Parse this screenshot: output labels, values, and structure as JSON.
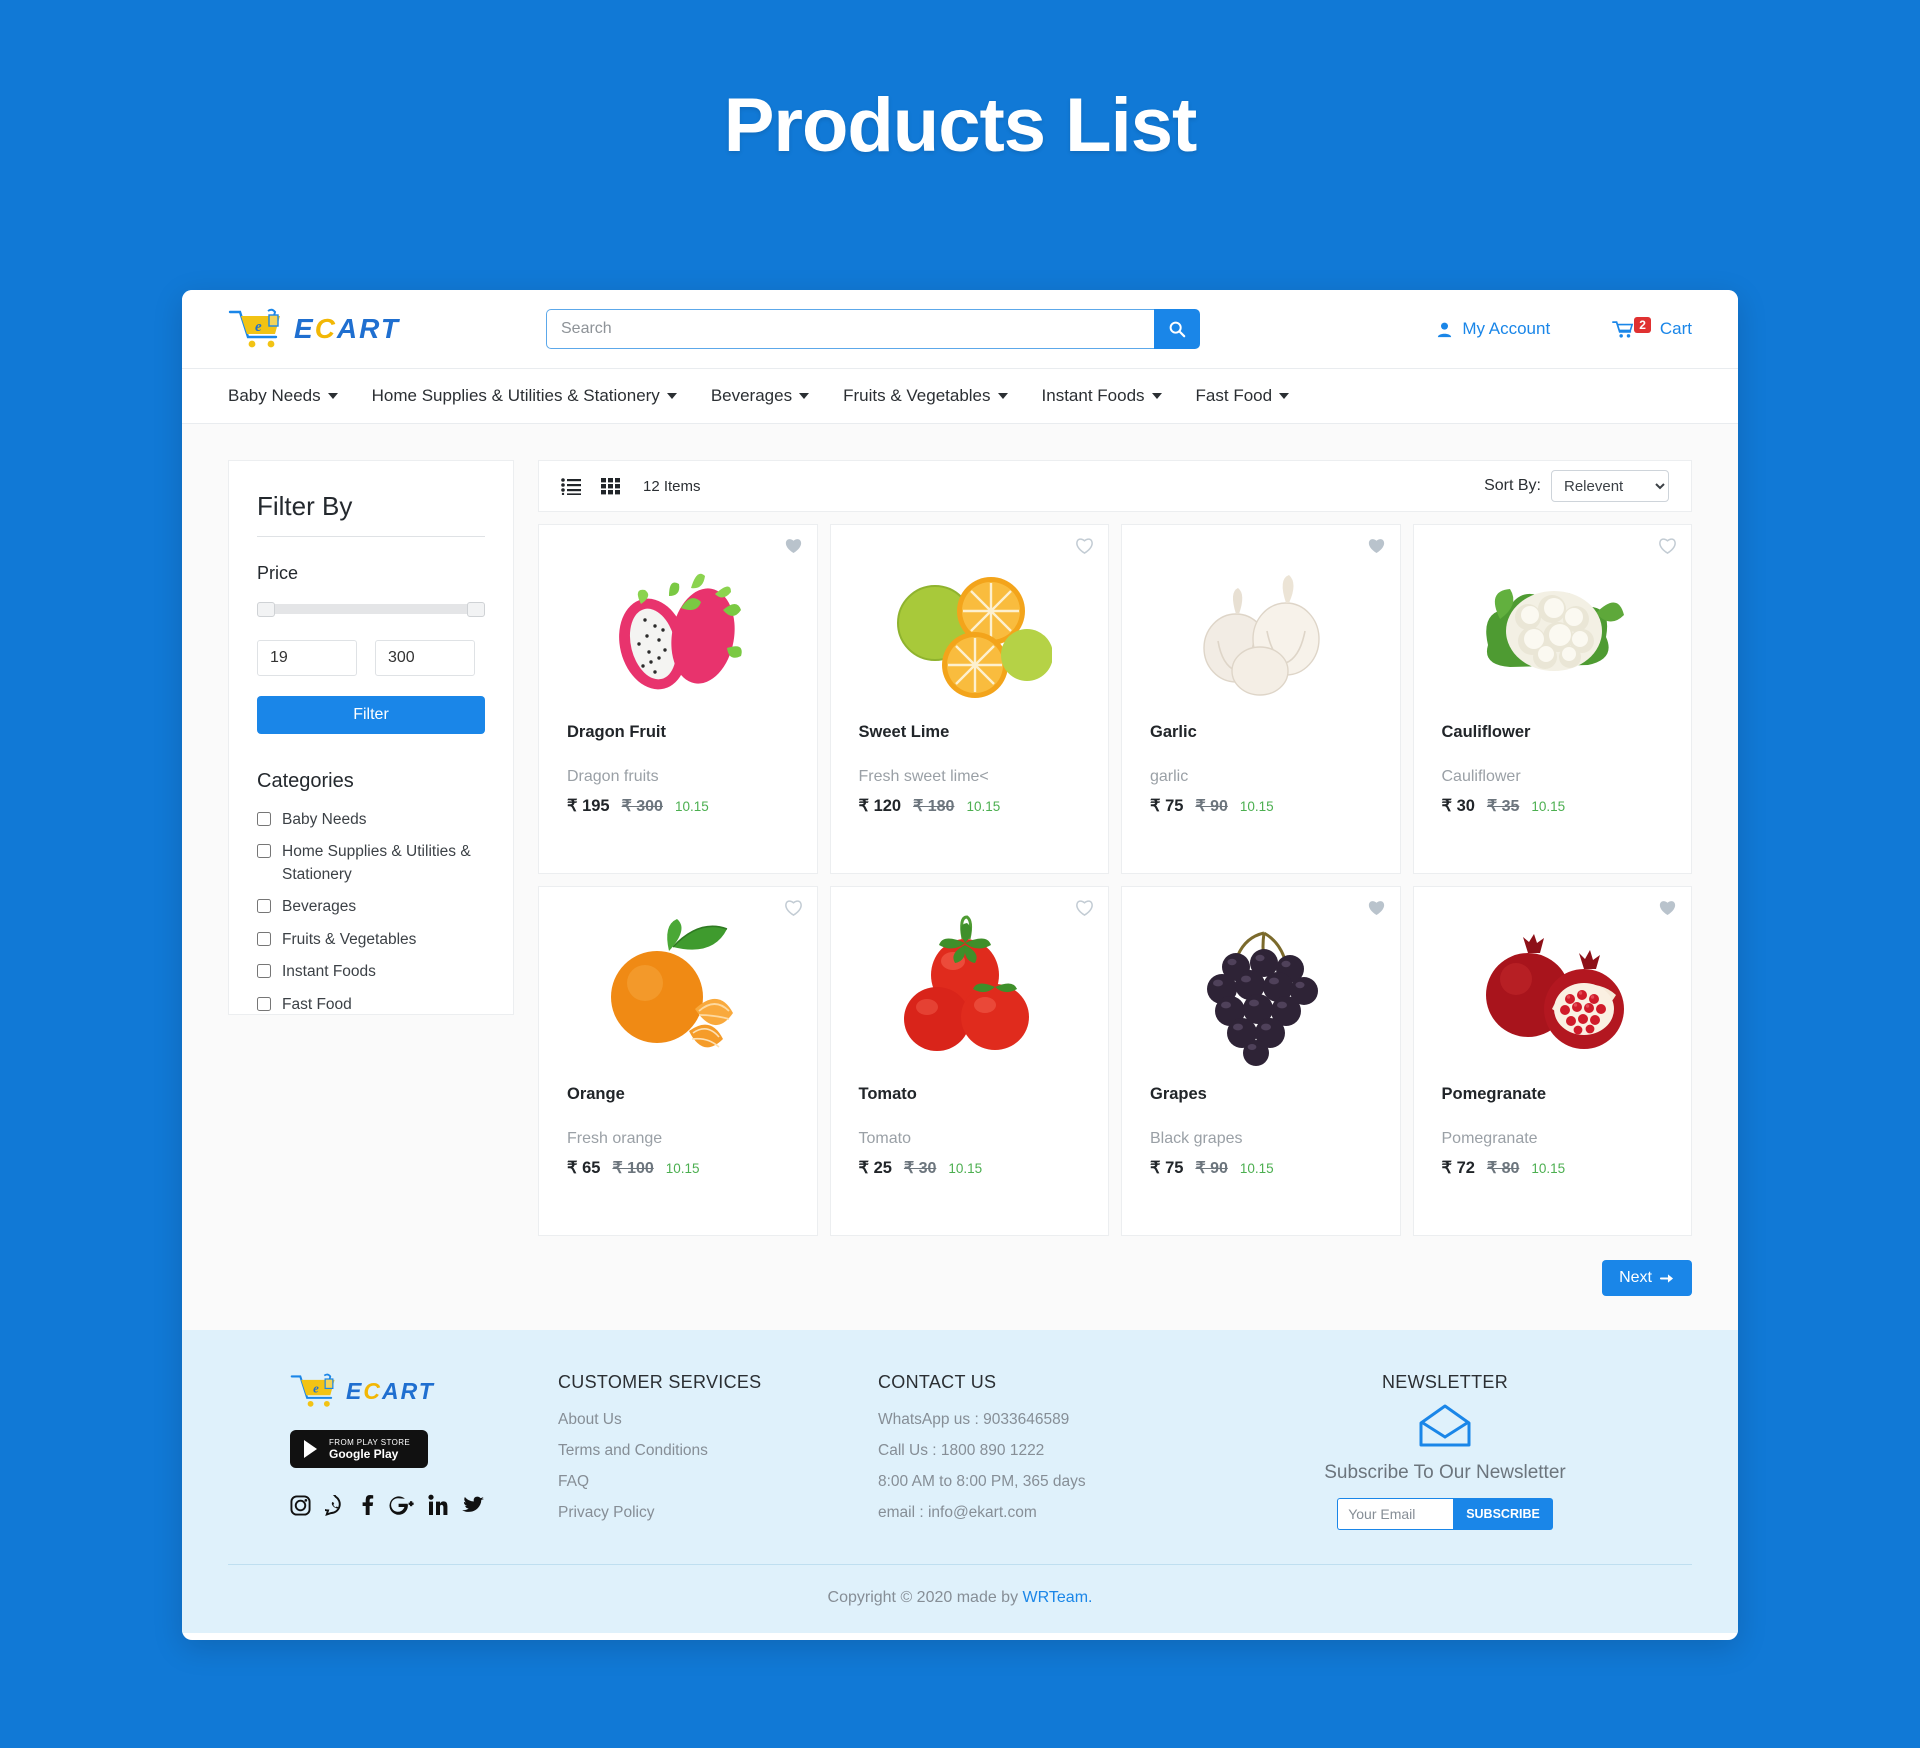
{
  "page": {
    "title": "Products List"
  },
  "header": {
    "logo": {
      "prefix": "E",
      "accent": "C",
      "suffix": "ART",
      "icon": "shopping-cart-icon"
    },
    "search": {
      "placeholder": "Search",
      "value": "",
      "button_icon": "search-icon"
    },
    "account": {
      "label": "My Account",
      "icon": "user-icon"
    },
    "cart": {
      "label": "Cart",
      "count": "2",
      "icon": "cart-icon"
    }
  },
  "nav": {
    "items": [
      {
        "label": "Baby Needs"
      },
      {
        "label": "Home Supplies & Utilities & Stationery"
      },
      {
        "label": "Beverages"
      },
      {
        "label": "Fruits & Vegetables"
      },
      {
        "label": "Instant Foods"
      },
      {
        "label": "Fast Food"
      }
    ]
  },
  "sidebar": {
    "filter_title": "Filter By",
    "price_label": "Price",
    "price_min": "19",
    "price_max": "300",
    "filter_button": "Filter",
    "categories_title": "Categories",
    "categories": [
      {
        "label": "Baby Needs",
        "checked": false
      },
      {
        "label": "Home Supplies & Utilities & Stationery",
        "checked": false
      },
      {
        "label": "Beverages",
        "checked": false
      },
      {
        "label": "Fruits & Vegetables",
        "checked": false
      },
      {
        "label": "Instant Foods",
        "checked": false
      },
      {
        "label": "Fast Food",
        "checked": false
      }
    ]
  },
  "toolbar": {
    "list_view_icon": "list-view-icon",
    "grid_view_icon": "grid-view-icon",
    "items_count": "12 Items",
    "sort_label": "Sort By:",
    "sort_value": "Relevent",
    "sort_options": [
      "Relevent"
    ]
  },
  "products": [
    {
      "name": "Dragon Fruit",
      "desc": "Dragon fruits",
      "price": "₹ 195",
      "old_price": "₹ 300",
      "discount": "10.15",
      "favorite": true,
      "image": "dragon-fruit"
    },
    {
      "name": "Sweet Lime",
      "desc": "Fresh sweet lime<",
      "price": "₹ 120",
      "old_price": "₹ 180",
      "discount": "10.15",
      "favorite": false,
      "image": "sweet-lime"
    },
    {
      "name": "Garlic",
      "desc": "garlic",
      "price": "₹ 75",
      "old_price": "₹ 90",
      "discount": "10.15",
      "favorite": true,
      "image": "garlic"
    },
    {
      "name": "Cauliflower",
      "desc": "Cauliflower",
      "price": "₹ 30",
      "old_price": "₹ 35",
      "discount": "10.15",
      "favorite": false,
      "image": "cauliflower"
    },
    {
      "name": "Orange",
      "desc": "Fresh orange",
      "price": "₹ 65",
      "old_price": "₹ 100",
      "discount": "10.15",
      "favorite": false,
      "image": "orange"
    },
    {
      "name": "Tomato",
      "desc": "Tomato",
      "price": "₹ 25",
      "old_price": "₹ 30",
      "discount": "10.15",
      "favorite": false,
      "image": "tomato"
    },
    {
      "name": "Grapes",
      "desc": "Black grapes",
      "price": "₹ 75",
      "old_price": "₹ 90",
      "discount": "10.15",
      "favorite": true,
      "image": "grapes"
    },
    {
      "name": "Pomegranate",
      "desc": "Pomegranate",
      "price": "₹ 72",
      "old_price": "₹ 80",
      "discount": "10.15",
      "favorite": true,
      "image": "pomegranate"
    }
  ],
  "pagination": {
    "next_label": "Next"
  },
  "footer": {
    "logo": {
      "prefix": "E",
      "accent": "C",
      "suffix": "ART"
    },
    "playstore": {
      "line1": "FROM PLAY STORE",
      "line2": "Google Play"
    },
    "socials": [
      "instagram-icon",
      "whatsapp-icon",
      "facebook-icon",
      "google-plus-icon",
      "linkedin-icon",
      "twitter-icon"
    ],
    "customer_services": {
      "title": "CUSTOMER SERVICES",
      "links": [
        "About Us",
        "Terms and Conditions",
        "FAQ",
        "Privacy Policy"
      ]
    },
    "contact": {
      "title": "CONTACT US",
      "lines": [
        "WhatsApp us : 9033646589",
        "Call Us : 1800 890 1222",
        "8:00 AM to 8:00 PM, 365 days",
        "email : info@ekart.com"
      ]
    },
    "newsletter": {
      "title": "NEWSLETTER",
      "icon": "envelope-icon",
      "subtitle": "Subscribe To Our Newsletter",
      "placeholder": "Your Email",
      "button": "SUBSCRIBE"
    },
    "copyright_prefix": "Copyright © 2020 made by ",
    "copyright_link": "WRTeam."
  },
  "colors": {
    "brand_blue": "#1179d6",
    "accent_blue": "#1a86e8",
    "logo_yellow": "#f2b705",
    "discount_green": "#4caf50",
    "cart_badge_red": "#e03131",
    "footer_bg": "#dff1fb"
  }
}
